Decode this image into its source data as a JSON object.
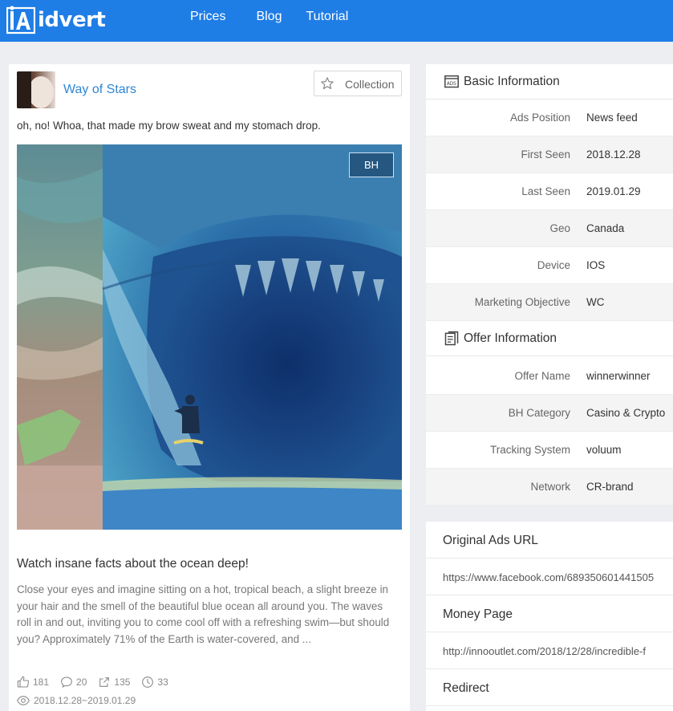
{
  "brand": {
    "name": "idvert",
    "primary_color": "#1f7de6"
  },
  "nav": {
    "items": [
      "Prices",
      "Blog",
      "Tutorial"
    ]
  },
  "post": {
    "page_name": "Way of Stars",
    "collection_label": "Collection",
    "text": "oh, no! Whoa, that made my brow sweat and my stomach drop.",
    "badge": "BH",
    "headline": "Watch insane facts about the ocean deep!",
    "description": "Close your eyes and imagine sitting on a hot, tropical beach, a slight breeze in your hair and the smell of the beautiful blue ocean all around you. The waves roll in and out, inviting you to come cool off with a refreshing swim—but should you? Approximately 71% of the Earth is water-covered, and ...",
    "stats": {
      "likes": "181",
      "comments": "20",
      "shares": "135",
      "time": "33"
    },
    "date_range": "2018.12.28~2019.01.29"
  },
  "basic_info": {
    "title": "Basic Information",
    "rows": [
      {
        "label": "Ads Position",
        "value": "News feed"
      },
      {
        "label": "First Seen",
        "value": "2018.12.28"
      },
      {
        "label": "Last Seen",
        "value": "2019.01.29"
      },
      {
        "label": "Geo",
        "value": "Canada"
      },
      {
        "label": "Device",
        "value": "IOS"
      },
      {
        "label": "Marketing Objective",
        "value": "WC"
      }
    ]
  },
  "offer_info": {
    "title": "Offer Information",
    "rows": [
      {
        "label": "Offer Name",
        "value": "winnerwinner"
      },
      {
        "label": "BH Category",
        "value": "Casino & Crypto"
      },
      {
        "label": "Tracking System",
        "value": "voluum"
      },
      {
        "label": "Network",
        "value": "CR-brand"
      }
    ]
  },
  "urls": {
    "original_title": "Original Ads URL",
    "original_value": "https://www.facebook.com/689350601441505",
    "money_title": "Money Page",
    "money_value": "http://innooutlet.com/2018/12/28/incredible-f",
    "redirect_title": "Redirect"
  }
}
